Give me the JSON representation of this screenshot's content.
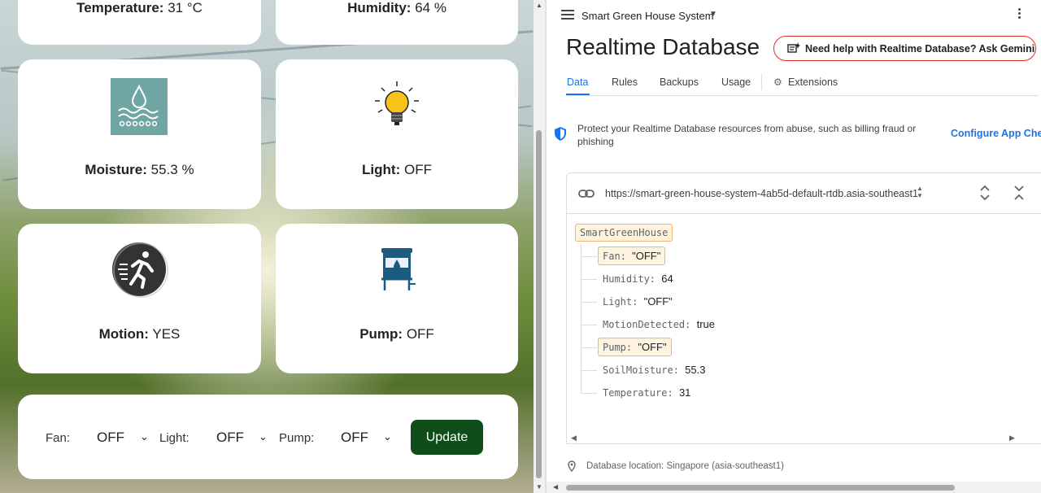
{
  "dashboard": {
    "temperature": {
      "label": "Temperature:",
      "value": "31 °C"
    },
    "humidity": {
      "label": "Humidity:",
      "value": "64 %"
    },
    "moisture": {
      "label": "Moisture:",
      "value": "55.3 %"
    },
    "light": {
      "label": "Light:",
      "value": "OFF"
    },
    "motion": {
      "label": "Motion:",
      "value": "YES"
    },
    "pump": {
      "label": "Pump:",
      "value": "OFF"
    },
    "controls": {
      "fan_label": "Fan:",
      "fan_value": "OFF",
      "light_label": "Light:",
      "light_value": "OFF",
      "pump_label": "Pump:",
      "pump_value": "OFF",
      "update_label": "Update"
    }
  },
  "console": {
    "project_name": "Smart Green House System",
    "title": "Realtime Database",
    "gemini_button": "Need help with Realtime Database? Ask Gemini",
    "tabs": [
      "Data",
      "Rules",
      "Backups",
      "Usage",
      "Extensions"
    ],
    "protect_text": "Protect your Realtime Database resources from abuse, such as billing fraud or phishing",
    "configure_link": "Configure App Che",
    "url": "https://smart-green-house-system-4ab5d-default-rtdb.asia-southeast1",
    "tree": {
      "root": "SmartGreenHouse",
      "children": [
        {
          "key": "Fan",
          "value": "\"OFF\""
        },
        {
          "key": "Humidity",
          "value": "64"
        },
        {
          "key": "Light",
          "value": "\"OFF\""
        },
        {
          "key": "MotionDetected",
          "value": "true"
        },
        {
          "key": "Pump",
          "value": "\"OFF\""
        },
        {
          "key": "SoilMoisture",
          "value": "55.3"
        },
        {
          "key": "Temperature",
          "value": "31"
        }
      ]
    },
    "db_location": "Database location: Singapore (asia-southeast1)"
  },
  "colors": {
    "accent_blue": "#1a73e8",
    "update_button": "#0f4d1a",
    "gemini_border": "#d93025",
    "highlight_bg": "#fff4e0",
    "highlight_border": "#f6b26b"
  },
  "icons": [
    "water-moisture-icon",
    "light-bulb-icon",
    "motion-runner-icon",
    "water-tank-pump-icon",
    "link-icon",
    "shield-icon",
    "pin-icon",
    "expand-icon",
    "collapse-icon",
    "hamburger-icon",
    "more-vert-icon",
    "gemini-icon",
    "extensions-icon"
  ]
}
